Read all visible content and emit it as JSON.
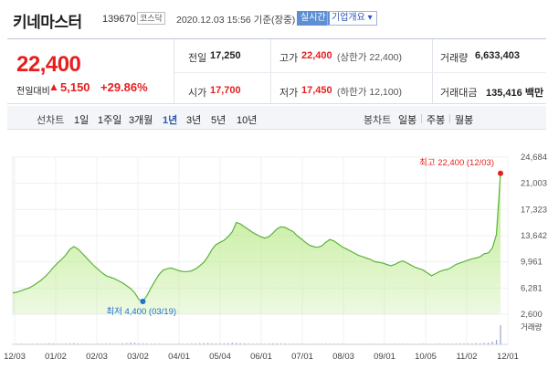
{
  "header": {
    "name": "키네마스터",
    "code": "139670",
    "market": "코스닥",
    "time": "2020.12.03 15:56  기준(장중)",
    "live_label": "실시간",
    "overview_label": "기업개요 ▾"
  },
  "summary": {
    "price": "22,400",
    "change_label": "전일대비",
    "change_arrow": "▲",
    "change_value": "5,150",
    "change_pct": "+29.86%",
    "prev_close_label": "전일",
    "prev_close": "17,250",
    "high_label": "고가",
    "high": "22,400",
    "high_sub": "(상한가 22,400)",
    "volume_label": "거래량",
    "volume": "6,633,403",
    "open_label": "시가",
    "open": "17,700",
    "low_label": "저가",
    "low": "17,450",
    "low_sub": "(하한가 12,100)",
    "amount_label": "거래대금",
    "amount": "135,416 백만"
  },
  "period_bar": {
    "line_chart_label": "선차트",
    "periods": [
      "1일",
      "1주일",
      "3개월",
      "1년",
      "3년",
      "5년",
      "10년"
    ],
    "active_period": "1년",
    "candle_chart_label": "봉차트",
    "candles": [
      "일봉",
      "주봉",
      "월봉"
    ]
  },
  "chart_data": {
    "type": "area",
    "x": [
      "12/03",
      "01/02",
      "02/03",
      "03/02",
      "04/01",
      "05/04",
      "06/01",
      "07/01",
      "08/03",
      "09/01",
      "10/05",
      "11/02",
      "12/01"
    ],
    "y_ticks": [
      "24,684",
      "21,003",
      "17,323",
      "13,642",
      "9,961",
      "6,281",
      "2,600"
    ],
    "ylim": [
      2600,
      24684
    ],
    "max_label": "최고 22,400 (12/03)",
    "min_label": "최저 4,400 (03/19)",
    "volume_label": "거래량",
    "series": [
      {
        "values": [
          5600,
          5700,
          5900,
          6100,
          6300,
          6600,
          7000,
          7400,
          7900,
          8500,
          9200,
          9800,
          10300,
          10900,
          11700,
          12100,
          11800,
          11200,
          10600,
          10000,
          9400,
          8900,
          8400,
          8000,
          7800,
          7600,
          7300,
          7000,
          6600,
          6200,
          5600,
          4700,
          4400,
          5200,
          6300,
          7300,
          8200,
          8800,
          9000,
          9100,
          8900,
          8700,
          8600,
          8600,
          8700,
          9000,
          9400,
          9900,
          10700,
          11700,
          12400,
          12700,
          13000,
          13500,
          14200,
          15500,
          15300,
          14900,
          14500,
          14100,
          13800,
          13500,
          13300,
          13500,
          14000,
          14600,
          14900,
          14800,
          14500,
          14200,
          13600,
          13200,
          12700,
          12300,
          12100,
          12000,
          12200,
          12700,
          13100,
          12900,
          12500,
          12100,
          11800,
          11500,
          11200,
          10900,
          10700,
          10500,
          10300,
          10000,
          9900,
          9800,
          9600,
          9400,
          9600,
          9900,
          10100,
          9800,
          9500,
          9200,
          9000,
          8800,
          8400,
          8000,
          8300,
          8600,
          8800,
          8900,
          9200,
          9600,
          9800,
          10000,
          10200,
          10400,
          10500,
          10700,
          11100,
          11200,
          11900,
          13800,
          22400
        ],
        "volume": [
          2,
          2,
          3,
          2,
          2,
          3,
          4,
          3,
          3,
          5,
          4,
          3,
          3,
          4,
          5,
          6,
          4,
          3,
          3,
          2,
          2,
          3,
          3,
          4,
          4,
          3,
          3,
          5,
          6,
          9,
          8,
          5,
          4,
          4,
          3,
          3,
          3,
          2,
          2,
          2,
          2,
          3,
          3,
          3,
          4,
          4,
          5,
          6,
          7,
          5,
          4,
          4,
          5,
          6,
          8,
          7,
          6,
          5,
          4,
          3,
          3,
          3,
          3,
          4,
          5,
          5,
          4,
          4,
          3,
          3,
          3,
          3,
          2,
          2,
          2,
          3,
          3,
          4,
          3,
          3,
          3,
          2,
          2,
          2,
          2,
          2,
          2,
          2,
          2,
          3,
          2,
          2,
          2,
          2,
          3,
          3,
          3,
          2,
          2,
          2,
          2,
          3,
          2,
          2,
          3,
          3,
          4,
          3,
          3,
          4,
          4,
          5,
          4,
          5,
          6,
          5,
          7,
          8,
          14,
          24,
          100
        ]
      }
    ]
  },
  "colors": {
    "up_red": "#e61e1e",
    "down_blue": "#1f6fd4",
    "area_fill": "#b8e986",
    "area_line": "#5cb33a",
    "volume_bar": "#9aa3c9"
  }
}
